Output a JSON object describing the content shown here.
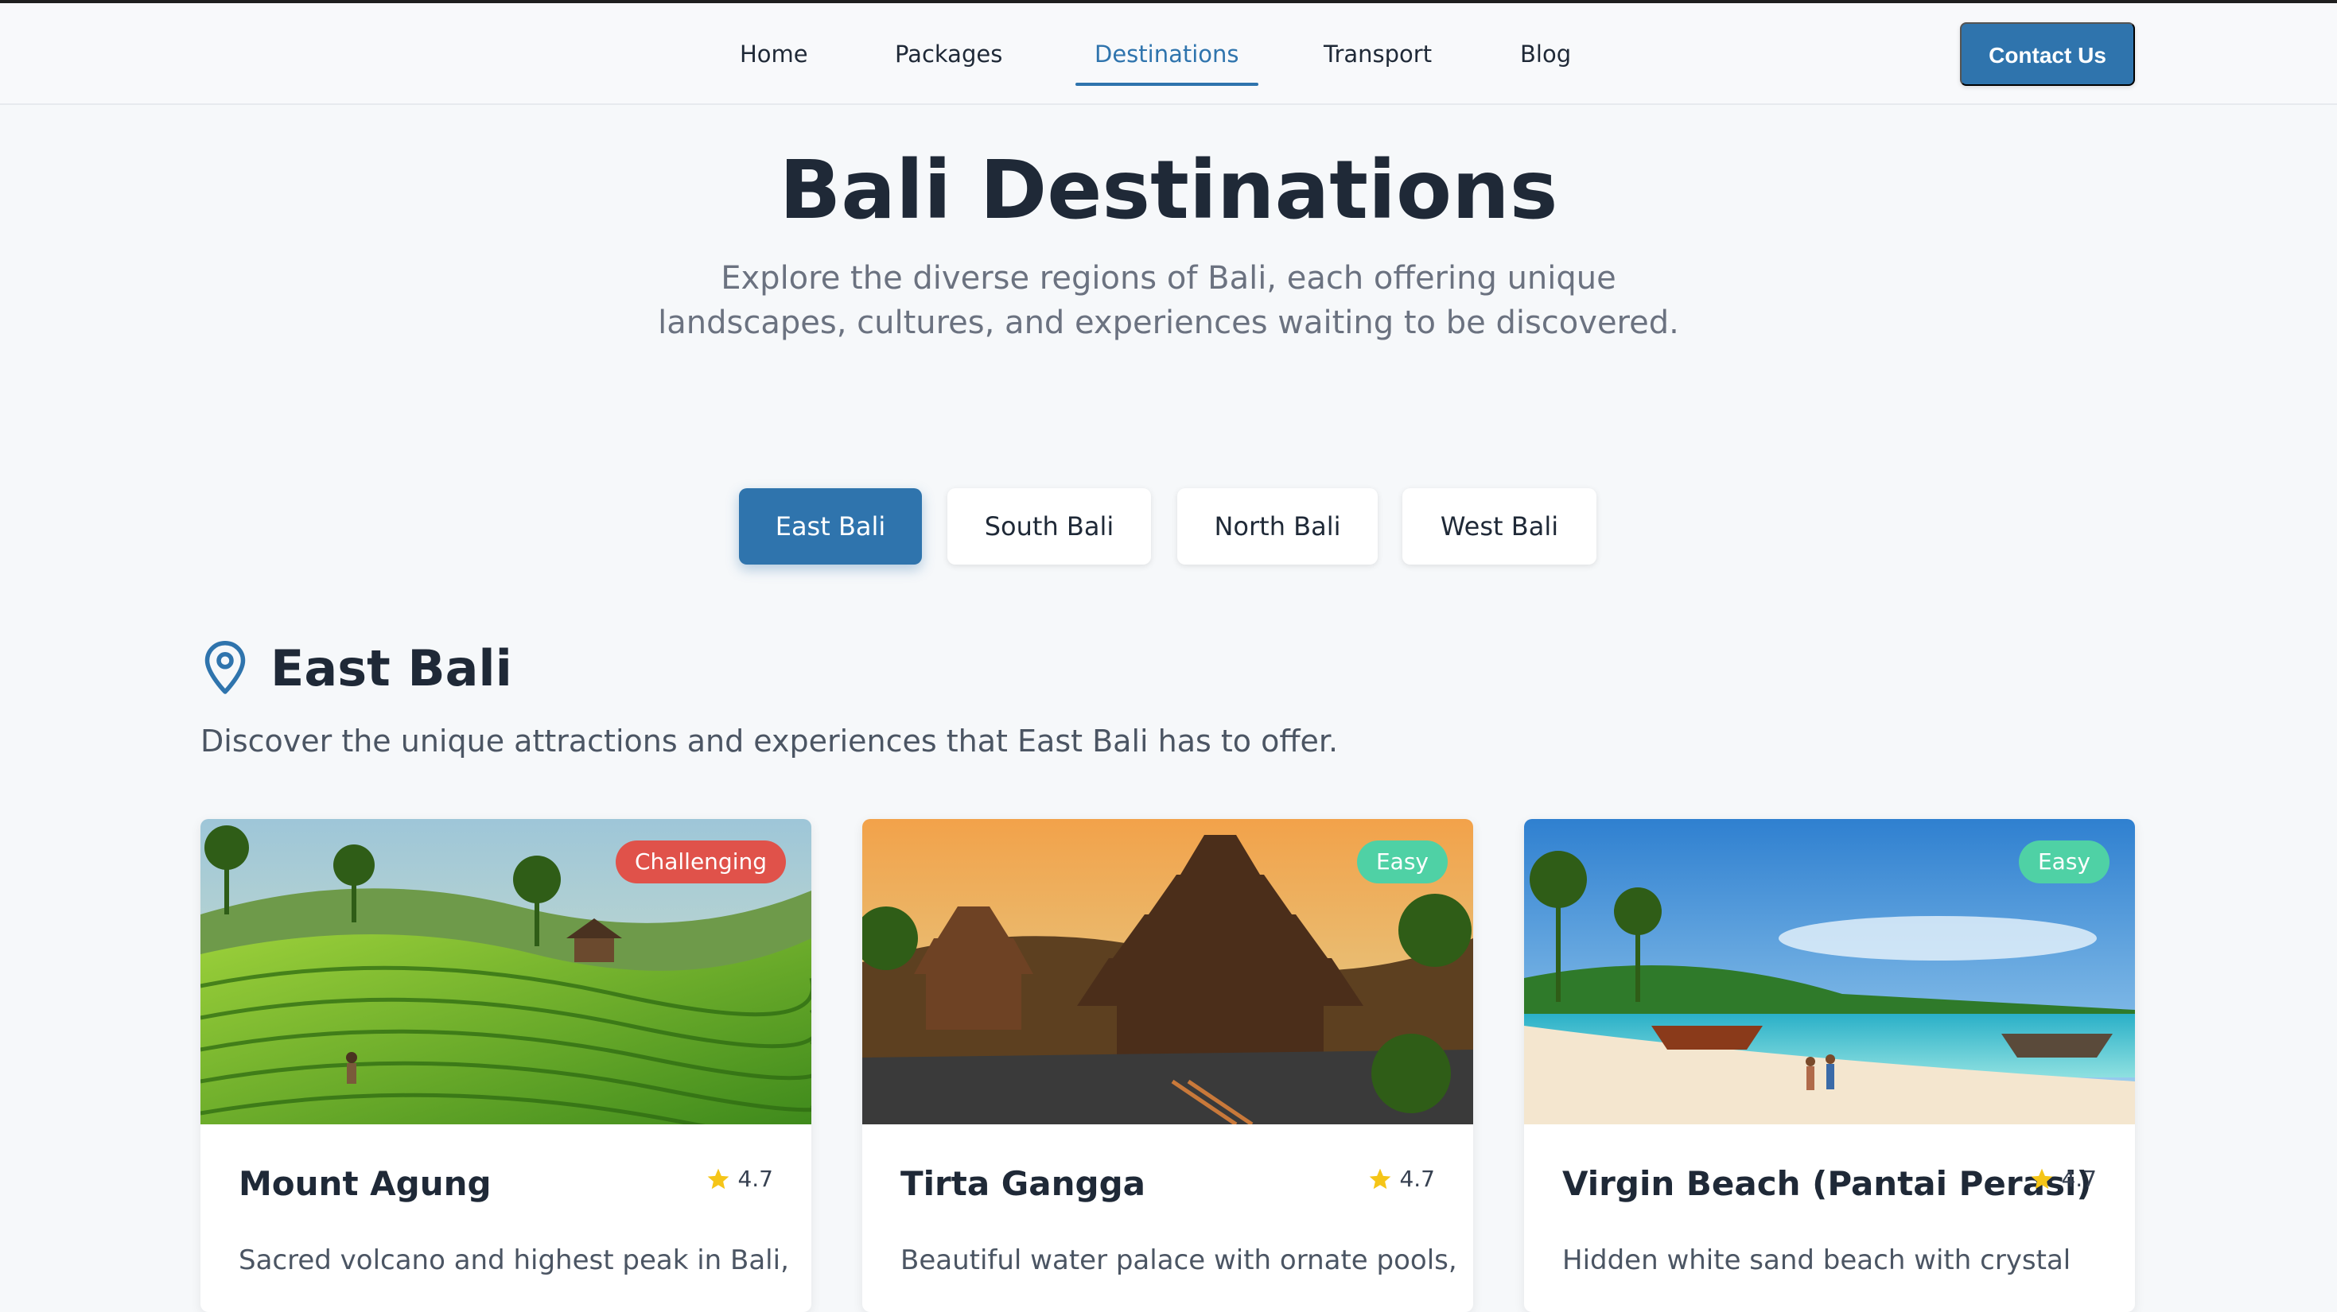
{
  "nav": {
    "links": [
      {
        "label": "Home"
      },
      {
        "label": "Packages"
      },
      {
        "label": "Destinations"
      },
      {
        "label": "Transport"
      },
      {
        "label": "Blog"
      }
    ],
    "active": "Destinations",
    "contact_label": "Contact Us"
  },
  "hero": {
    "title": "Bali Destinations",
    "subtitle": "Explore the diverse regions of Bali, each offering unique landscapes, cultures, and experiences waiting to be discovered."
  },
  "region_tabs": [
    {
      "label": "East Bali",
      "active": true
    },
    {
      "label": "South Bali",
      "active": false
    },
    {
      "label": "North Bali",
      "active": false
    },
    {
      "label": "West Bali",
      "active": false
    }
  ],
  "region": {
    "icon": "map-pin-icon",
    "name": "East Bali",
    "description": "Discover the unique attractions and experiences that East Bali has to offer."
  },
  "cards": [
    {
      "title": "Mount Agung",
      "rating": "4.7",
      "difficulty": "Challenging",
      "difficulty_color": "#e0524a",
      "description": "Sacred volcano and highest peak in Bali,"
    },
    {
      "title": "Tirta Gangga",
      "rating": "4.7",
      "difficulty": "Easy",
      "difficulty_color": "#4fd1a5",
      "description": "Beautiful water palace with ornate pools,"
    },
    {
      "title": "Virgin Beach (Pantai Perasi)",
      "rating": "4.7",
      "difficulty": "Easy",
      "difficulty_color": "#4fd1a5",
      "description": "Hidden white sand beach with crystal"
    }
  ],
  "colors": {
    "accent": "#2f74ad",
    "background": "#f6f8fa",
    "star": "#f5c518"
  }
}
